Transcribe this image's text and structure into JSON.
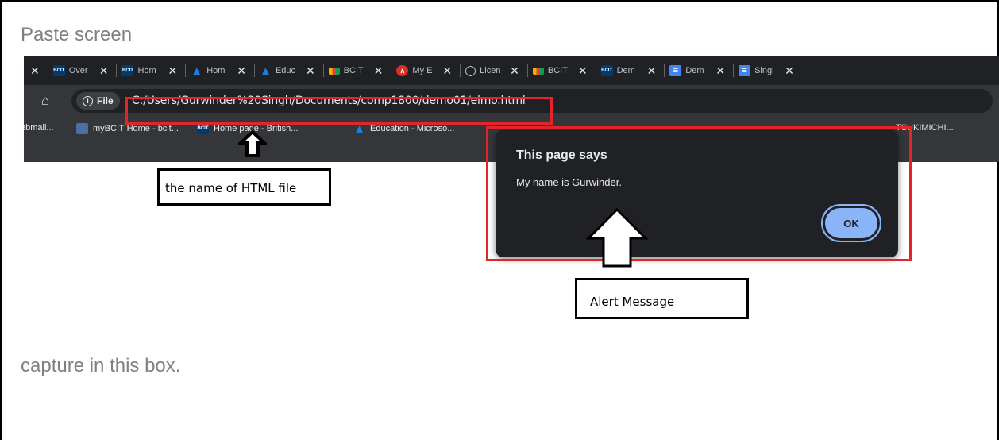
{
  "doc": {
    "paste_text": "Paste screen",
    "capture_text": "capture in this box."
  },
  "browser": {
    "tabs": [
      {
        "icon": "bcit-icon",
        "favtext": "BCIT",
        "title": "Over"
      },
      {
        "icon": "bcit-icon",
        "favtext": "BCIT",
        "title": "Hom"
      },
      {
        "icon": "azure-icon",
        "favtext": "▲",
        "title": "Hom"
      },
      {
        "icon": "azure-icon",
        "favtext": "▲",
        "title": "Educ"
      },
      {
        "icon": "multicolor-icon",
        "favtext": "",
        "title": "BCIT"
      },
      {
        "icon": "red-circle-icon",
        "favtext": "∧",
        "title": "My E"
      },
      {
        "icon": "globe-icon",
        "favtext": "",
        "title": "Licen"
      },
      {
        "icon": "multicolor-icon",
        "favtext": "",
        "title": "BCIT"
      },
      {
        "icon": "bcit-icon",
        "favtext": "BCIT",
        "title": "Dem"
      },
      {
        "icon": "docs-icon",
        "favtext": "≡",
        "title": "Dem"
      },
      {
        "icon": "docs-icon",
        "favtext": "≡",
        "title": "Singl"
      }
    ],
    "file_chip": "File",
    "url": "C:/Users/Gurwinder%20Singh/Documents/comp1800/demo01/elmo.html",
    "bookmarks": {
      "b1": "ebmail...",
      "b2": "myBCIT Home - bcit...",
      "b3": "Home page - British...",
      "b4": "Education - Microso...",
      "b5": "TSUKIMICHI..."
    }
  },
  "dialog": {
    "title": "This page says",
    "message": "My name is Gurwinder.",
    "ok_label": "OK"
  },
  "annotations": {
    "html_file_label": "the name of HTML file",
    "alert_label": "Alert Message",
    "highlight_color": "#e0262a"
  }
}
